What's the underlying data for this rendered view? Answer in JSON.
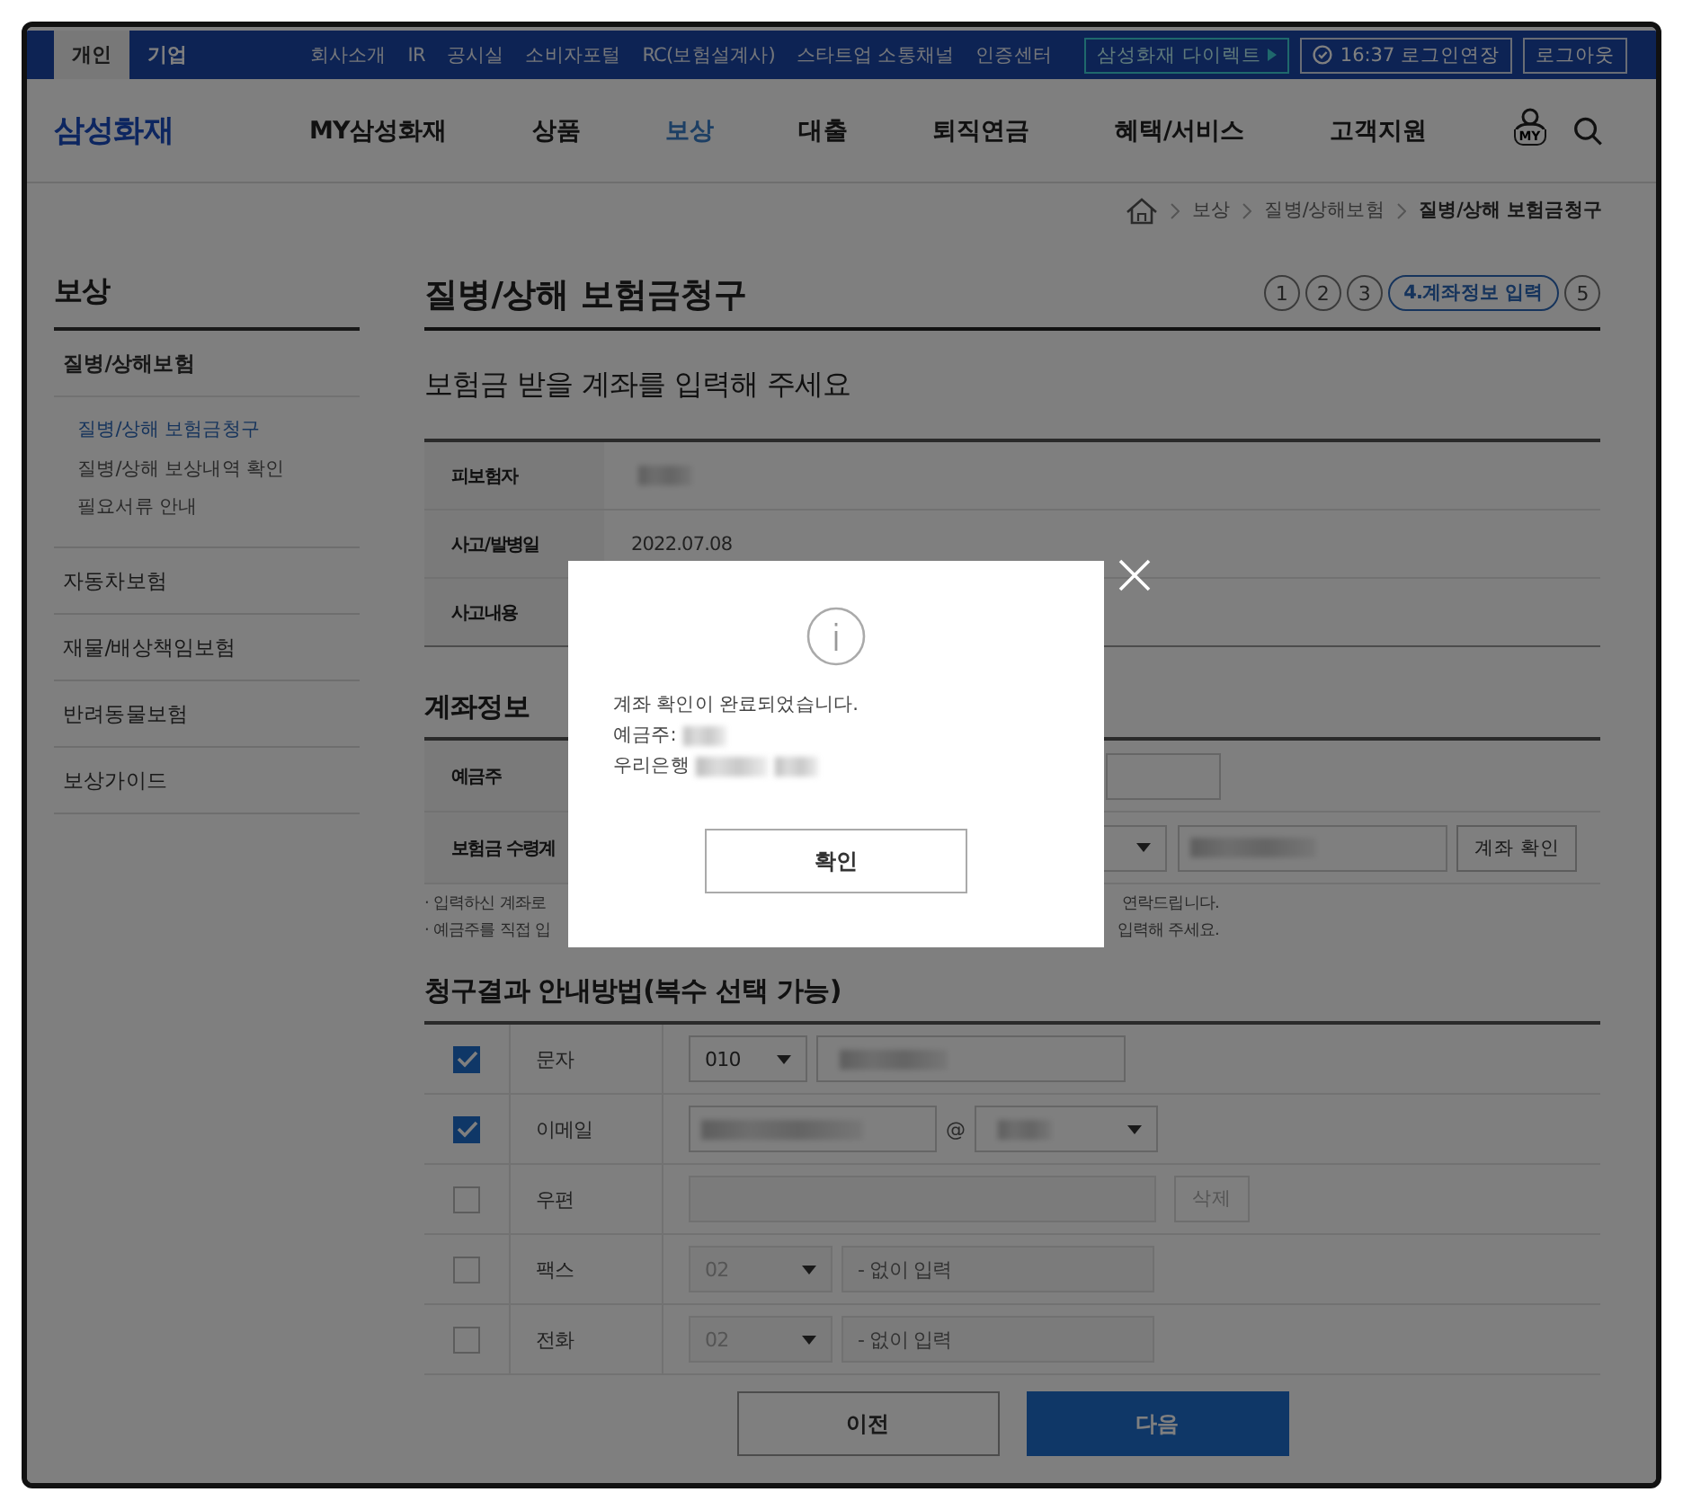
{
  "top_bar": {
    "tabs": [
      {
        "label": "개인",
        "selected": true
      },
      {
        "label": "기업",
        "selected": false
      }
    ],
    "links": [
      "회사소개",
      "IR",
      "공시실",
      "소비자포털",
      "RC(보험설계사)",
      "스타트업 소통채널",
      "인증센터"
    ],
    "direct_button": "삼성화재 다이렉트",
    "session_button": "16:37 로그인연장",
    "logout_button": "로그아웃"
  },
  "header": {
    "logo": "삼성화재",
    "my_label": "MY",
    "menu": [
      {
        "label": "MY삼성화재",
        "selected": false
      },
      {
        "label": "상품",
        "selected": false
      },
      {
        "label": "보상",
        "selected": true
      },
      {
        "label": "대출",
        "selected": false
      },
      {
        "label": "퇴직연금",
        "selected": false
      },
      {
        "label": "혜택/서비스",
        "selected": false
      },
      {
        "label": "고객지원",
        "selected": false
      }
    ]
  },
  "breadcrumb": [
    "보상",
    "질병/상해보험",
    "질병/상해 보험금청구"
  ],
  "sidebar": {
    "title": "보상",
    "items": [
      {
        "label": "질병/상해보험",
        "expanded": true,
        "children": [
          {
            "label": "질병/상해 보험금청구",
            "selected": true
          },
          {
            "label": "질병/상해 보상내역 확인",
            "selected": false
          },
          {
            "label": "필요서류 안내",
            "selected": false
          }
        ]
      },
      {
        "label": "자동차보험",
        "expanded": false
      },
      {
        "label": "재물/배상책임보험",
        "expanded": false
      },
      {
        "label": "반려동물보험",
        "expanded": false
      },
      {
        "label": "보상가이드",
        "expanded": false
      }
    ]
  },
  "page": {
    "title": "질병/상해 보험금청구",
    "steps": [
      {
        "label": "1",
        "selected": false
      },
      {
        "label": "2",
        "selected": false
      },
      {
        "label": "3",
        "selected": false
      },
      {
        "label": "4.계좌정보 입력",
        "selected": true
      },
      {
        "label": "5",
        "selected": false
      }
    ],
    "subtitle": "보험금 받을 계좌를 입력해 주세요",
    "claim_info": [
      {
        "label": "피보험자",
        "redacted": true
      },
      {
        "label": "사고/발병일",
        "value": "2022.07.08"
      },
      {
        "label": "사고내용"
      }
    ],
    "account": {
      "heading": "계좌정보",
      "rows": [
        {
          "kind": "holder",
          "label": "예금주"
        },
        {
          "kind": "account",
          "label": "보험금 수령계",
          "redacted": true,
          "button": "계좌 확인"
        }
      ],
      "notes": [
        {
          "start": "· 입력하신 계좌로",
          "end": "연락드립니다."
        },
        {
          "start": "· 예금주를 직접 입",
          "end": "입력해 주세요."
        }
      ]
    },
    "notify": {
      "heading": "청구결과 안내방법(복수 선택 가능)",
      "rows": [
        {
          "kind": "phone",
          "label": "문자",
          "checked": true,
          "prefix": "010",
          "redacted": true
        },
        {
          "kind": "email",
          "label": "이메일",
          "checked": true,
          "at": "@",
          "redacted": true
        },
        {
          "kind": "address",
          "label": "우편",
          "checked": false,
          "button": "삭제"
        },
        {
          "kind": "phone",
          "label": "팩스",
          "checked": false,
          "prefix": "02",
          "placeholder": "- 없이 입력"
        },
        {
          "kind": "phone",
          "label": "전화",
          "checked": false,
          "prefix": "02",
          "placeholder": "- 없이 입력"
        }
      ]
    },
    "buttons": [
      {
        "label": "이전",
        "kind": "secondary"
      },
      {
        "label": "다음",
        "kind": "primary"
      }
    ]
  },
  "modal": {
    "message": "계좌 확인이 완료되었습니다.",
    "holder_label": "예금주:",
    "bank": "우리은행",
    "confirm_button": "확인"
  }
}
